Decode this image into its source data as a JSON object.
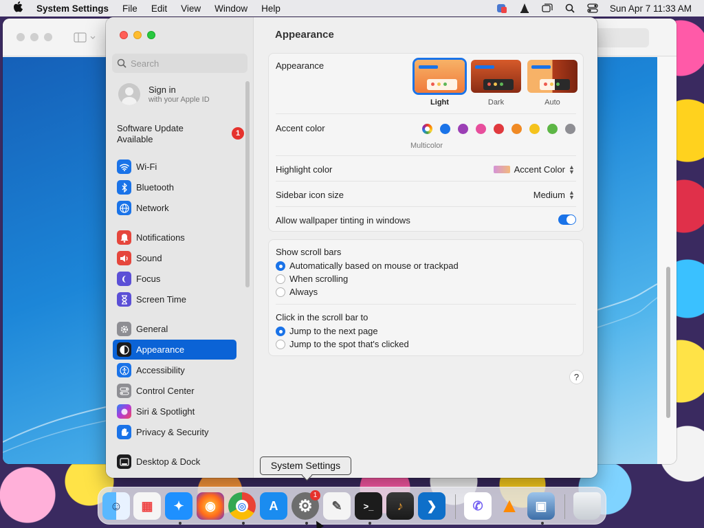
{
  "menubar": {
    "app_name": "System Settings",
    "menus": [
      "File",
      "Edit",
      "View",
      "Window",
      "Help"
    ],
    "clock": "Sun Apr 7  11:33 AM",
    "status_icons": [
      "app-badge-icon",
      "vlc-icon",
      "window-icon",
      "search-icon",
      "control-center-icon"
    ]
  },
  "sidebar": {
    "search_placeholder": "Search",
    "account": {
      "title": "Sign in",
      "subtitle": "with your Apple ID"
    },
    "update": {
      "label": "Software Update Available",
      "badge": "1"
    },
    "items": [
      {
        "label": "Wi-Fi",
        "icon": "wifi-icon",
        "color": "#1a73e8"
      },
      {
        "label": "Bluetooth",
        "icon": "bluetooth-icon",
        "color": "#1a73e8"
      },
      {
        "label": "Network",
        "icon": "globe-icon",
        "color": "#1a73e8"
      },
      {
        "label": "Notifications",
        "icon": "bell-icon",
        "color": "#e5463c"
      },
      {
        "label": "Sound",
        "icon": "speaker-icon",
        "color": "#e5463c"
      },
      {
        "label": "Focus",
        "icon": "moon-icon",
        "color": "#5b4fd6"
      },
      {
        "label": "Screen Time",
        "icon": "hourglass-icon",
        "color": "#5b4fd6"
      },
      {
        "label": "General",
        "icon": "gear-icon",
        "color": "#8e8e93"
      },
      {
        "label": "Appearance",
        "icon": "appearance-icon",
        "color": "#1c1c1e"
      },
      {
        "label": "Accessibility",
        "icon": "accessibility-icon",
        "color": "#1a73e8"
      },
      {
        "label": "Control Center",
        "icon": "control-center-icon",
        "color": "#8e8e93"
      },
      {
        "label": "Siri & Spotlight",
        "icon": "siri-icon",
        "color": "#b03ad8"
      },
      {
        "label": "Privacy & Security",
        "icon": "hand-icon",
        "color": "#1a73e8"
      },
      {
        "label": "Desktop & Dock",
        "icon": "dock-icon",
        "color": "#1c1c1e"
      }
    ],
    "active": "Appearance"
  },
  "main": {
    "title": "Appearance",
    "appearance": {
      "label": "Appearance",
      "options": [
        "Light",
        "Dark",
        "Auto"
      ],
      "selected": "Light"
    },
    "accent": {
      "label": "Accent color",
      "multicolor_label": "Multicolor",
      "colors": [
        "multicolor",
        "#1a73e8",
        "#9b3fb5",
        "#e74e9c",
        "#e0393e",
        "#f08a24",
        "#f5c31c",
        "#5db645",
        "#8e8e93"
      ]
    },
    "highlight": {
      "label": "Highlight color",
      "value": "Accent Color"
    },
    "sidebar_icon_size": {
      "label": "Sidebar icon size",
      "value": "Medium"
    },
    "wallpaper_tinting": {
      "label": "Allow wallpaper tinting in windows",
      "enabled": true
    },
    "scroll_bars": {
      "label": "Show scroll bars",
      "options": [
        "Automatically based on mouse or trackpad",
        "When scrolling",
        "Always"
      ],
      "selected": "Automatically based on mouse or trackpad"
    },
    "click_scroll": {
      "label": "Click in the scroll bar to",
      "options": [
        "Jump to the next page",
        "Jump to the spot that's clicked"
      ],
      "selected": "Jump to the next page"
    },
    "help": "?"
  },
  "tooltip": "System Settings",
  "dock": {
    "apps": [
      {
        "name": "finder-icon",
        "color": "#2f8ef0",
        "glyph": "☺"
      },
      {
        "name": "launchpad-icon",
        "color": "#f5f5f5",
        "glyph": "▦"
      },
      {
        "name": "safari-icon",
        "color": "#1e90ff",
        "glyph": "✦"
      },
      {
        "name": "firefox-icon",
        "color": "#ff6b1a",
        "glyph": "◉"
      },
      {
        "name": "chrome-icon",
        "color": "#ffffff",
        "glyph": "◎"
      },
      {
        "name": "app-store-icon",
        "color": "#1a8cf0",
        "glyph": "A"
      },
      {
        "name": "system-settings-icon",
        "color": "#6d6d6d",
        "glyph": "⚙"
      },
      {
        "name": "textedit-icon",
        "color": "#f4f4f4",
        "glyph": "✎"
      },
      {
        "name": "terminal-icon",
        "color": "#1c1c1c",
        "glyph": ">_"
      },
      {
        "name": "garageband-icon",
        "color": "#2b2b2b",
        "glyph": "♪"
      },
      {
        "name": "vscode-icon",
        "color": "#0e6fc9",
        "glyph": "❯"
      },
      {
        "name": "viber-icon",
        "color": "#7360f2",
        "glyph": "✆"
      },
      {
        "name": "vlc-icon",
        "color": "#ff8a00",
        "glyph": "▲"
      },
      {
        "name": "preview-icon",
        "color": "#5f8fc7",
        "glyph": "▣"
      },
      {
        "name": "trash-icon",
        "color": "#d9dde2",
        "glyph": ""
      }
    ],
    "settings_badge": "1"
  }
}
